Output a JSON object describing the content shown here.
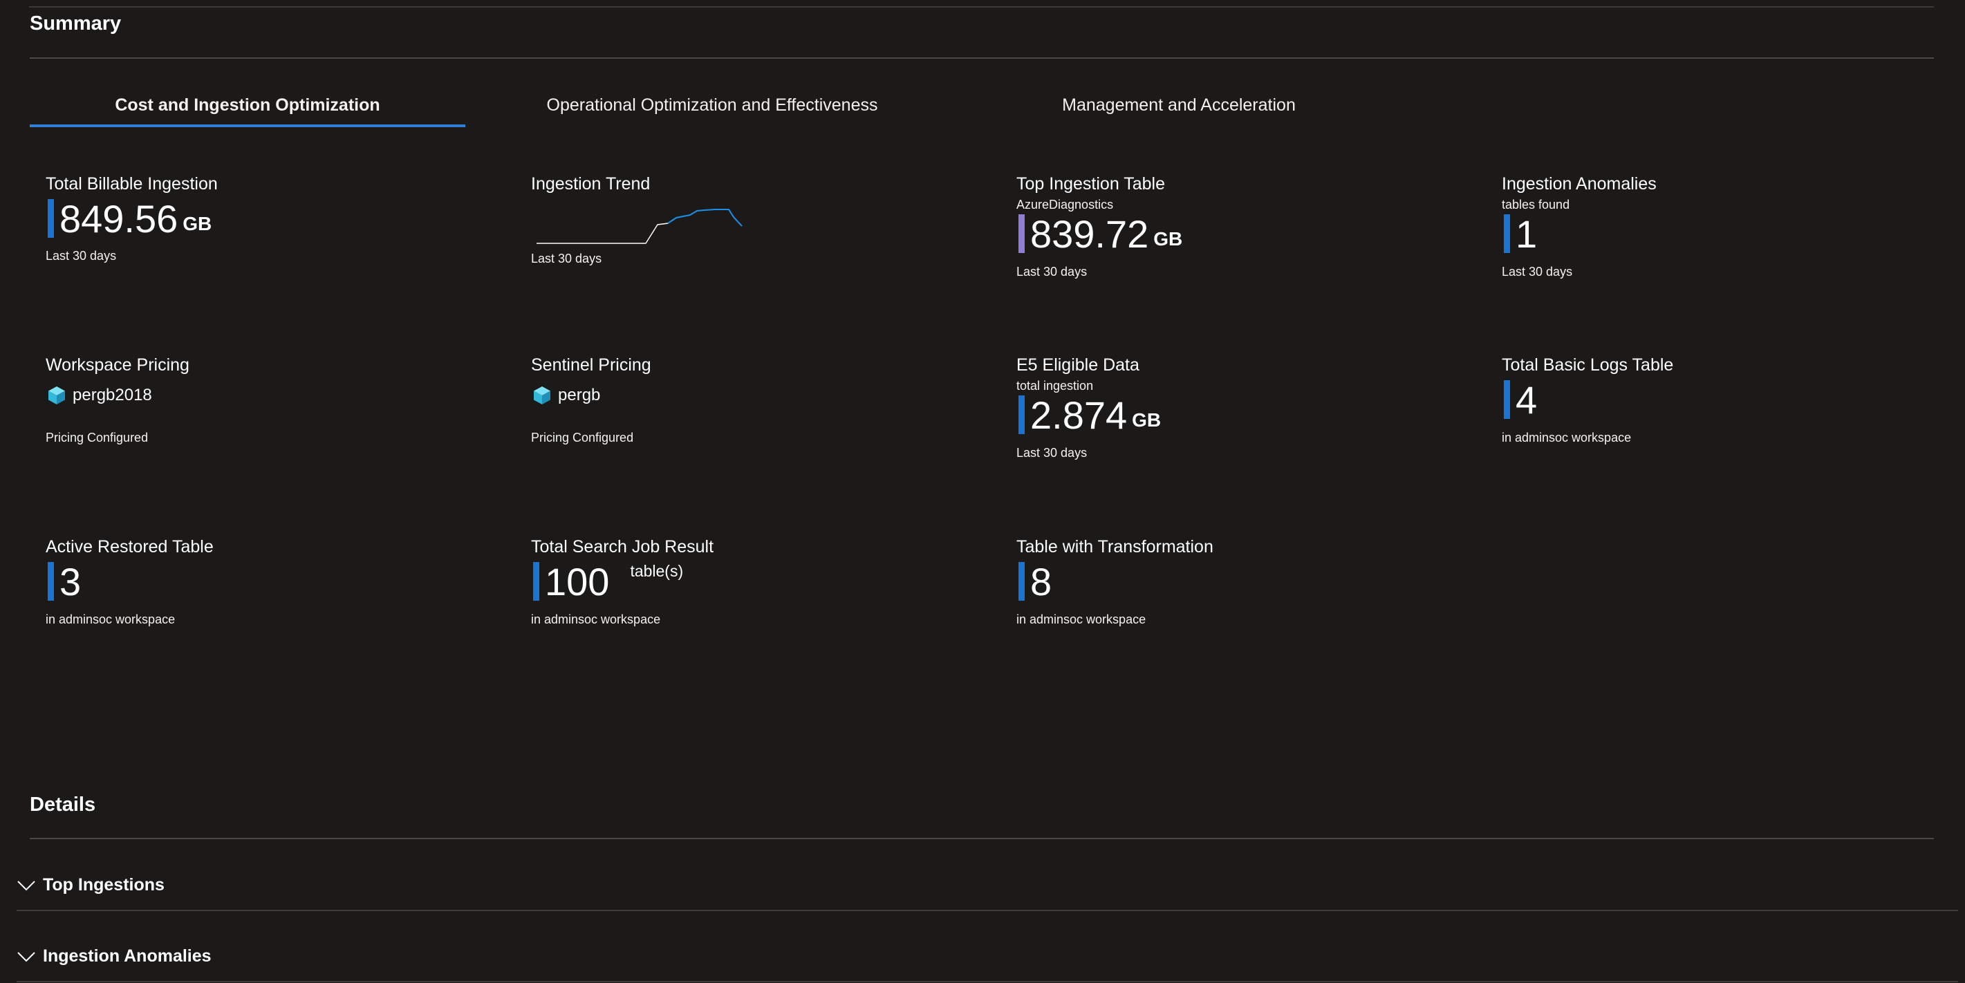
{
  "summary": {
    "title": "Summary",
    "tabs": [
      "Cost and Ingestion Optimization",
      "Operational Optimization and Effectiveness",
      "Management and Acceleration"
    ],
    "tiles": {
      "billable": {
        "title": "Total Billable Ingestion",
        "value": "849.56",
        "unit": "GB",
        "footer": "Last 30 days"
      },
      "trend": {
        "title": "Ingestion Trend",
        "footer": "Last 30 days",
        "line_color": "#1b8ee6"
      },
      "top_table": {
        "title": "Top Ingestion Table",
        "subtitle": "AzureDiagnostics",
        "value": "839.72",
        "unit": "GB",
        "footer": "Last 30 days"
      },
      "anomalies": {
        "title": "Ingestion Anomalies",
        "subtitle": "tables found",
        "value": "1",
        "footer": "Last 30 days"
      },
      "workspace_pricing": {
        "title": "Workspace Pricing",
        "value": "pergb2018",
        "icon": "cube-icon",
        "footer": "Pricing Configured"
      },
      "sentinel_pricing": {
        "title": "Sentinel Pricing",
        "value": "pergb",
        "icon": "cube-icon",
        "footer": "Pricing Configured"
      },
      "e5": {
        "title": "E5 Eligible Data",
        "subtitle": "total ingestion",
        "value": "2.874",
        "unit": "GB",
        "footer": "Last 30 days"
      },
      "basic_logs": {
        "title": "Total Basic Logs Table",
        "value": "4",
        "footer": "in adminsoc workspace"
      },
      "restored": {
        "title": "Active Restored Table",
        "value": "3",
        "footer": "in adminsoc workspace"
      },
      "search_job": {
        "title": "Total Search Job Result",
        "value": "100",
        "unit": "table(s)",
        "footer": "in adminsoc workspace"
      },
      "transformation": {
        "title": "Table with Transformation",
        "value": "8",
        "footer": "in adminsoc workspace"
      }
    }
  },
  "details": {
    "title": "Details",
    "sections": [
      "Top Ingestions",
      "Ingestion Anomalies"
    ]
  },
  "colors": {
    "background": "#1b1a19",
    "accent_blue": "#1b74d1",
    "accent_purple": "#8f7dd6",
    "tab_underline": "#2f7fd6"
  }
}
